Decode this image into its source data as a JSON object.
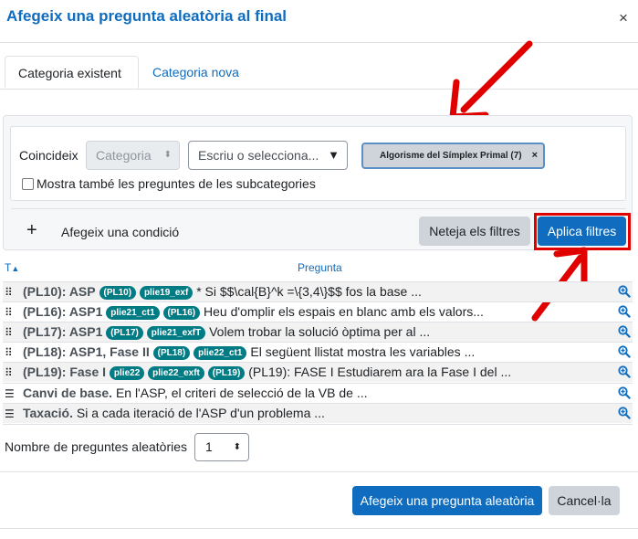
{
  "dialog": {
    "title": "Afegeix una pregunta aleatòria al final",
    "close_glyph": "×"
  },
  "tabs": [
    {
      "label": "Categoria existent",
      "active": true
    },
    {
      "label": "Categoria nova",
      "active": false
    }
  ],
  "filters": {
    "match_label": "Coincideix",
    "category_select": "Categoria",
    "search_placeholder": "Escriu o selecciona...",
    "selected_chip": "Algorisme del Símplex Primal (7)",
    "chip_remove": "×",
    "subcategories_label": "Mostra també les preguntes de les subcategories",
    "subcategories_checked": false,
    "add_condition_label": "Afegeix una condició",
    "clear_button": "Neteja els filtres",
    "apply_button": "Aplica filtres"
  },
  "table": {
    "col_type": "T",
    "col_question": "Pregunta",
    "rows": [
      {
        "icon": "cloze-icon",
        "name": "(PL10): ASP",
        "tags": [
          "(PL10)",
          "plie19_exf"
        ],
        "text": "* Si $$\\cal{B}^k =\\{3,4\\}$$ fos la base ..."
      },
      {
        "icon": "cloze-icon",
        "name": "(PL16): ASP1",
        "tags": [
          "plie21_ct1",
          "(PL16)"
        ],
        "text": "Heu d'omplir els espais en blanc amb els valors..."
      },
      {
        "icon": "cloze-icon",
        "name": "(PL17): ASP1",
        "tags": [
          "(PL17)",
          "plie21_exfT"
        ],
        "text": "Volem trobar la solució òptima per al ..."
      },
      {
        "icon": "cloze-icon",
        "name": "(PL18): ASP1, Fase II",
        "tags": [
          "(PL18)",
          "plie22_ct1"
        ],
        "text": "El següent llistat mostra les variables ..."
      },
      {
        "icon": "cloze-icon",
        "name": "(PL19): Fase I",
        "tags": [
          "plie22",
          "plie22_exft",
          "(PL19)"
        ],
        "text": "(PL19): FASE I Estudiarem ara la Fase I del ..."
      },
      {
        "icon": "multichoice-icon",
        "name": "Canvi de base.",
        "tags": [],
        "text": "En l'ASP, el criteri de selecció de la VB de ..."
      },
      {
        "icon": "multichoice-icon",
        "name": "Taxació.",
        "tags": [],
        "text": "Si a cada iteració de l'ASP d'un problema ..."
      }
    ]
  },
  "random_count": {
    "label": "Nombre de preguntes aleatòries",
    "value": "1"
  },
  "footer": {
    "add_button": "Afegeix una pregunta aleatòria",
    "cancel_button": "Cancel·la"
  },
  "colors": {
    "primary": "#0f6cbf",
    "tag": "#017b84",
    "annotation": "#e00000"
  }
}
